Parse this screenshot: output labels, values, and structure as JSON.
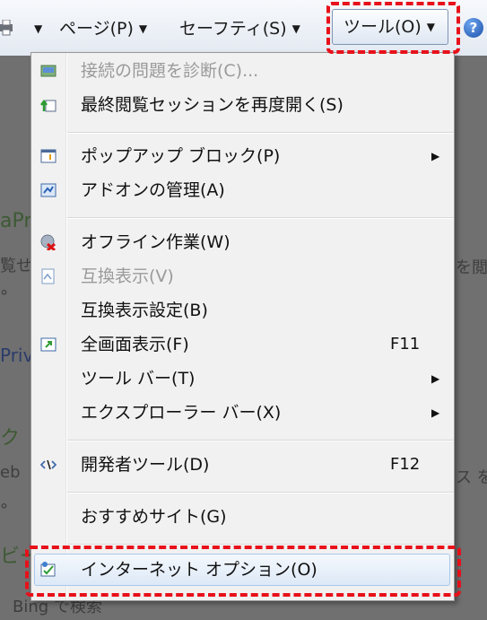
{
  "toolbar": {
    "page_label": "ページ(P)",
    "safety_label": "セーフティ(S)",
    "tools_label": "ツール(O)",
    "help_symbol": "?",
    "printer_icon": "printer-icon",
    "help_icon": "help-icon"
  },
  "background_page": {
    "fragments": [
      "aPr",
      "覧せ",
      "°",
      "Priv",
      "ク",
      "eb",
      "°",
      "ビー",
      "Bing で検索",
      "を閲",
      "ス を閲"
    ]
  },
  "menu": {
    "items": [
      {
        "label": "接続の問題を診断(C)...",
        "disabled": true,
        "icon": "network-diagnose-icon"
      },
      {
        "label": "最終閲覧セッションを再度開く(S)",
        "disabled": false,
        "icon": "reopen-session-icon"
      },
      {
        "label": "ポップアップ ブロック(P)",
        "disabled": false,
        "icon": "popup-block-icon",
        "submenu": true
      },
      {
        "label": "アドオンの管理(A)",
        "disabled": false,
        "icon": "addon-icon"
      },
      {
        "label": "オフライン作業(W)",
        "disabled": false,
        "icon": "offline-icon"
      },
      {
        "label": "互換表示(V)",
        "disabled": true,
        "icon": "compat-view-icon"
      },
      {
        "label": "互換表示設定(B)",
        "disabled": false
      },
      {
        "label": "全画面表示(F)",
        "disabled": false,
        "icon": "fullscreen-icon",
        "shortcut": "F11"
      },
      {
        "label": "ツール バー(T)",
        "disabled": false,
        "submenu": true
      },
      {
        "label": "エクスプローラー バー(X)",
        "disabled": false,
        "submenu": true
      },
      {
        "label": "開発者ツール(D)",
        "disabled": false,
        "icon": "developer-tools-icon",
        "shortcut": "F12"
      },
      {
        "label": "おすすめサイト(G)",
        "disabled": false
      },
      {
        "label": "インターネット オプション(O)",
        "disabled": false,
        "icon": "internet-options-icon",
        "highlighted": true
      }
    ]
  },
  "colors": {
    "highlight_dash": "#e8101a",
    "menu_bg": "#f1f1f1",
    "disabled_text": "#9a9a9a"
  }
}
